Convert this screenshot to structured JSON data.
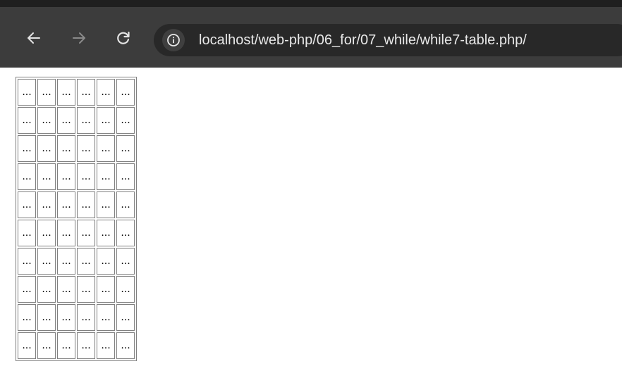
{
  "browser": {
    "url": "localhost/web-php/06_for/07_while/while7-table.php/",
    "icons": {
      "back": "arrow-left-icon",
      "forward": "arrow-right-icon",
      "reload": "reload-icon",
      "site_info": "info-circle-icon"
    },
    "colors": {
      "toolbar": "#3c3c3c",
      "omnibox": "#282828",
      "text": "#e8e8e8"
    }
  },
  "table": {
    "rows": [
      [
        "...",
        "...",
        "...",
        "...",
        "...",
        "..."
      ],
      [
        "...",
        "...",
        "...",
        "...",
        "...",
        "..."
      ],
      [
        "...",
        "...",
        "...",
        "...",
        "...",
        "..."
      ],
      [
        "...",
        "...",
        "...",
        "...",
        "...",
        "..."
      ],
      [
        "...",
        "...",
        "...",
        "...",
        "...",
        "..."
      ],
      [
        "...",
        "...",
        "...",
        "...",
        "...",
        "..."
      ],
      [
        "...",
        "...",
        "...",
        "...",
        "...",
        "..."
      ],
      [
        "...",
        "...",
        "...",
        "...",
        "...",
        "..."
      ],
      [
        "...",
        "...",
        "...",
        "...",
        "...",
        "..."
      ],
      [
        "...",
        "...",
        "...",
        "...",
        "...",
        "..."
      ]
    ]
  }
}
